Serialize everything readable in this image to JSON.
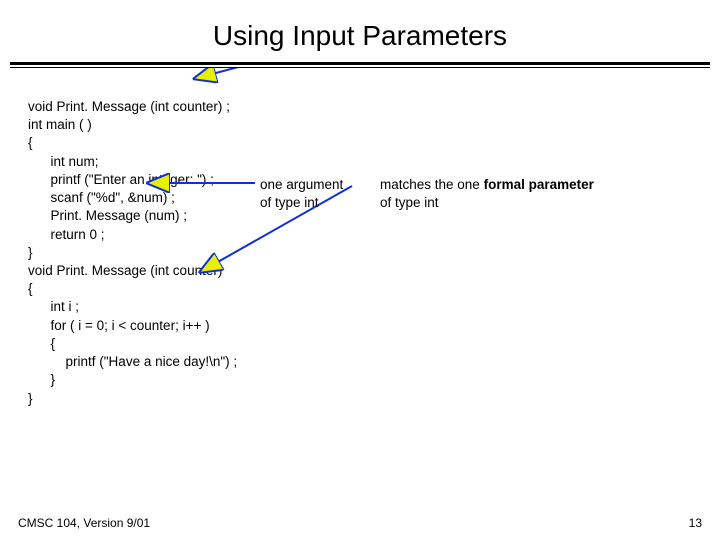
{
  "title": "Using Input Parameters",
  "code": {
    "l1": "void Print. Message (int counter) ;",
    "l2": "int main ( )",
    "l3": "{",
    "l4": "      int num;",
    "l5": "      printf (\"Enter an integer: \") ;",
    "l6": "      scanf (\"%d\", &num) ;",
    "l7": "      Print. Message (num) ;",
    "l8": "      return 0 ;",
    "l9": "}",
    "l10": "",
    "l11": "void Print. Message (int counter)",
    "l12": "{",
    "l13": "      int i ;",
    "l14": "      for ( i = 0; i < counter; i++ )",
    "l15": "      {",
    "l16": "          printf (\"Have a nice day!\\n\") ;",
    "l17": "      }",
    "l18": "}"
  },
  "annot": {
    "arg1": "one argument",
    "arg2": "of  type int",
    "match1_a": "matches the one ",
    "match1_b": "formal parameter",
    "match2": "of type int"
  },
  "footer": {
    "left": "CMSC 104, Version 9/01",
    "right": "13"
  },
  "colors": {
    "arrow": "#1030d8",
    "arrowhead": "#e8f000"
  }
}
